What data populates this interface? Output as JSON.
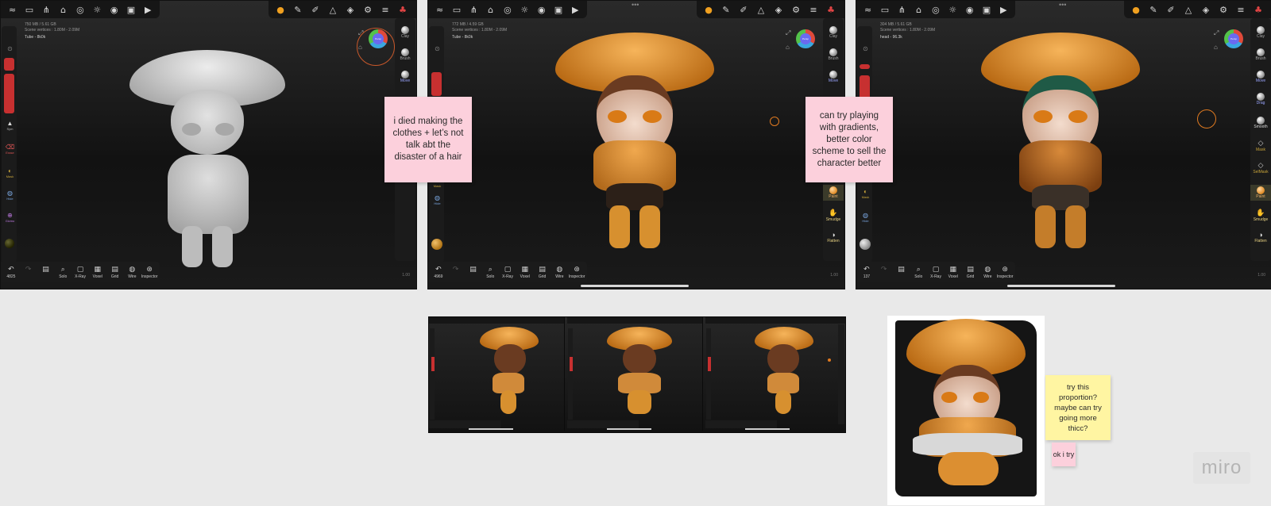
{
  "colors": {
    "canvas": "#e9e9e9",
    "sticky_pink": "#fcd0dc",
    "sticky_yellow": "#fff5a2",
    "accent_red": "#c73030",
    "clay_grey": "#c8c8c8",
    "pumpkin_orange": "#e08a23"
  },
  "panels": [
    {
      "info_line1": "750 MB / 5.61 GB",
      "info_line2": "Scene vertices : 1.80M - 2.09M",
      "object": "Tube - 8k0k",
      "undo_count": "4825",
      "zoom": "1.00",
      "sym_label": "Sym",
      "left_tools": [
        "Erase",
        "Mask",
        "Hide",
        "Gizmo"
      ],
      "right_tools": [
        "Clay",
        "Brush",
        "Move"
      ]
    },
    {
      "info_line1": "772 MB / 4.59 GB",
      "info_line2": "Scene vertices : 1.80M - 2.09M",
      "object": "Tube - 8k0k",
      "undo_count": "4969",
      "zoom": "1.00",
      "left_tools": [
        "Mask",
        "Hide"
      ],
      "right_tools": [
        "Clay",
        "Brush",
        "Move",
        "Paint",
        "Smudge",
        "Flatten"
      ]
    },
    {
      "info_line1": "304 MB / 5.61 GB",
      "info_line2": "Scene vertices : 1.80M - 2.09M",
      "object": "head - 96.3k",
      "undo_count": "137",
      "zoom": "1.00",
      "left_tools": [
        "Mask",
        "Hide"
      ],
      "right_tools": [
        "Clay",
        "Brush",
        "Move",
        "Drag",
        "Smooth",
        "Mask",
        "SelMask",
        "Paint",
        "Smudge",
        "Flatten"
      ]
    }
  ],
  "bottom_tools": [
    {
      "label": "Solo",
      "icon": "solo-icon",
      "glyph": "⌕"
    },
    {
      "label": "X-Ray",
      "icon": "xray-icon",
      "glyph": "▢"
    },
    {
      "label": "Voxel",
      "icon": "voxel-icon",
      "glyph": "▦"
    },
    {
      "label": "Grid",
      "icon": "grid-icon",
      "glyph": "▤"
    },
    {
      "label": "Wire",
      "icon": "wire-icon",
      "glyph": "◍"
    },
    {
      "label": "Inspector",
      "icon": "inspector-icon",
      "glyph": "⊛"
    }
  ],
  "gizmo_label": "Persp",
  "stickies": {
    "note1": "i died making the clothes + let’s not talk abt the disaster of a hair",
    "note2": "can try playing with gradients, better color scheme to sell the character better",
    "note3": "try this proportion? maybe can try going more thicc?",
    "note4": "ok i try"
  },
  "brand": "miro"
}
